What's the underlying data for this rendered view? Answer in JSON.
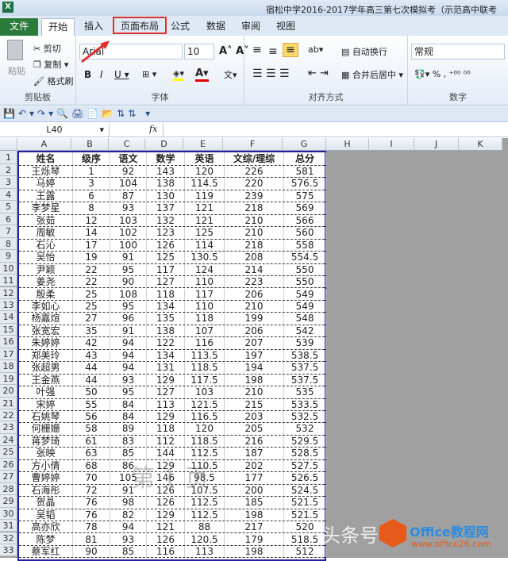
{
  "window": {
    "title": "宿松中学2016-2017学年高三第七次模拟考（示范高中联考"
  },
  "tabs": [
    "文件",
    "开始",
    "插入",
    "页面布局",
    "公式",
    "数据",
    "审阅",
    "视图"
  ],
  "ribbon": {
    "clipboard": {
      "paste": "粘贴",
      "cut": "剪切",
      "copy": "复制",
      "format_painter": "格式刷",
      "label": "剪贴板"
    },
    "font": {
      "name": "Arial",
      "size": "10",
      "label": "字体"
    },
    "alignment": {
      "wrap": "自动换行",
      "merge": "合并后居中",
      "label": "对齐方式"
    },
    "number": {
      "format": "常规",
      "label": "数字"
    }
  },
  "formula_bar": {
    "name_box": "L40",
    "fx": "fx",
    "value": ""
  },
  "columns": [
    "A",
    "B",
    "C",
    "D",
    "E",
    "F",
    "G",
    "H",
    "I",
    "J",
    "K"
  ],
  "table": {
    "headers": [
      "姓名",
      "级序",
      "语文",
      "数学",
      "英语",
      "文综/理综",
      "总分"
    ],
    "rows": [
      [
        "王烁琴",
        "1",
        "92",
        "143",
        "120",
        "226",
        "581"
      ],
      [
        "马婷",
        "3",
        "104",
        "138",
        "114.5",
        "220",
        "576.5"
      ],
      [
        "王露",
        "6",
        "87",
        "130",
        "119",
        "239",
        "575"
      ],
      [
        "李梦星",
        "8",
        "93",
        "137",
        "121",
        "218",
        "569"
      ],
      [
        "张茹",
        "12",
        "103",
        "132",
        "121",
        "210",
        "566"
      ],
      [
        "周敏",
        "14",
        "102",
        "123",
        "125",
        "210",
        "560"
      ],
      [
        "石沁",
        "17",
        "100",
        "126",
        "114",
        "218",
        "558"
      ],
      [
        "吴怡",
        "19",
        "91",
        "125",
        "130.5",
        "208",
        "554.5"
      ],
      [
        "尹颖",
        "22",
        "95",
        "117",
        "124",
        "214",
        "550"
      ],
      [
        "姜尧",
        "22",
        "90",
        "127",
        "110",
        "223",
        "550"
      ],
      [
        "殷柔",
        "25",
        "108",
        "118",
        "117",
        "206",
        "549"
      ],
      [
        "李如心",
        "25",
        "95",
        "134",
        "110",
        "210",
        "549"
      ],
      [
        "杨嘉煊",
        "27",
        "96",
        "135",
        "118",
        "199",
        "548"
      ],
      [
        "张宽宏",
        "35",
        "91",
        "138",
        "107",
        "206",
        "542"
      ],
      [
        "朱婷婷",
        "42",
        "94",
        "122",
        "116",
        "207",
        "539"
      ],
      [
        "郑美玲",
        "43",
        "94",
        "134",
        "113.5",
        "197",
        "538.5"
      ],
      [
        "张超男",
        "44",
        "94",
        "131",
        "118.5",
        "194",
        "537.5"
      ],
      [
        "王金燕",
        "44",
        "93",
        "129",
        "117.5",
        "198",
        "537.5"
      ],
      [
        "叶强",
        "50",
        "95",
        "127",
        "103",
        "210",
        "535"
      ],
      [
        "宋婷",
        "55",
        "84",
        "113",
        "121.5",
        "215",
        "533.5"
      ],
      [
        "石姚琴",
        "56",
        "84",
        "129",
        "116.5",
        "203",
        "532.5"
      ],
      [
        "何栅姗",
        "58",
        "89",
        "118",
        "120",
        "205",
        "532"
      ],
      [
        "蒋梦琦",
        "61",
        "83",
        "112",
        "118.5",
        "216",
        "529.5"
      ],
      [
        "张映",
        "63",
        "85",
        "144",
        "112.5",
        "187",
        "528.5"
      ],
      [
        "方小倩",
        "68",
        "86",
        "129",
        "110.5",
        "202",
        "527.5"
      ],
      [
        "曹婷婷",
        "70",
        "105",
        "146",
        "98.5",
        "177",
        "526.5"
      ],
      [
        "石海彤",
        "72",
        "91",
        "126",
        "107.5",
        "200",
        "524.5"
      ],
      [
        "贺晶",
        "76",
        "98",
        "126",
        "112.5",
        "185",
        "521.5"
      ],
      [
        "吴韬",
        "76",
        "82",
        "129",
        "112.5",
        "198",
        "521.5"
      ],
      [
        "高亦欣",
        "78",
        "94",
        "121",
        "88",
        "217",
        "520"
      ],
      [
        "陈梦",
        "81",
        "93",
        "126",
        "120.5",
        "179",
        "518.5"
      ],
      [
        "蔡军红",
        "90",
        "85",
        "116",
        "113",
        "198",
        "512"
      ]
    ]
  },
  "page_watermark": "第 1 页",
  "watermark": {
    "text": "头条号",
    "brand": "Office教程网",
    "url": "www.office26.com"
  }
}
